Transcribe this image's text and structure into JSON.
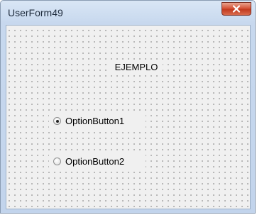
{
  "window": {
    "title": "UserForm49"
  },
  "form": {
    "label_text": "EJEMPLO",
    "options": [
      {
        "label": "OptionButton1",
        "selected": true
      },
      {
        "label": "OptionButton2",
        "selected": false
      }
    ]
  },
  "icons": {
    "close": "close-icon",
    "radio_checked": "radio-checked-icon",
    "radio_unchecked": "radio-unchecked-icon"
  },
  "colors": {
    "title_bar": "#c7d8ee",
    "close_button": "#c23b1f",
    "form_background": "#f0f0f0",
    "grid_dots": "#333333"
  }
}
